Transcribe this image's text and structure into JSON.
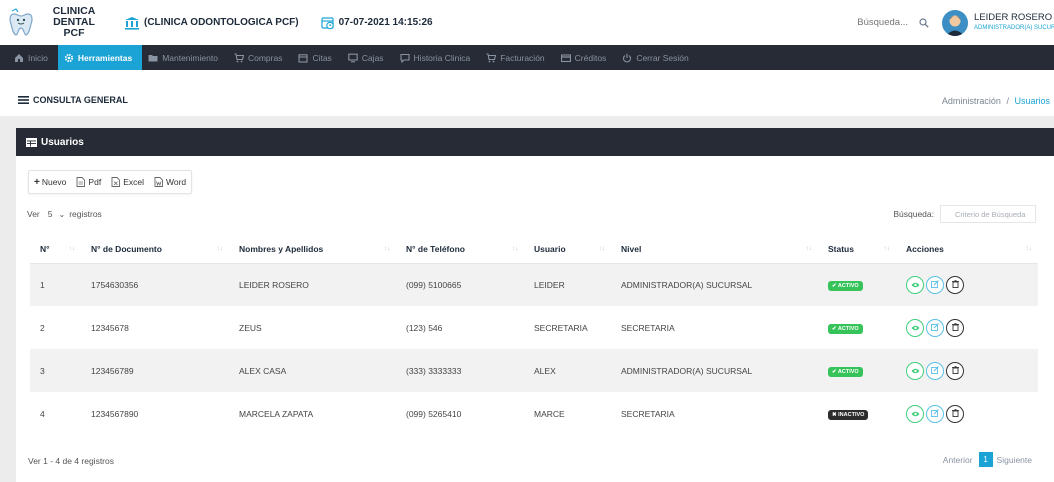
{
  "header": {
    "logo_line1": "CLINICA DENTAL",
    "logo_line2": "PCF",
    "clinic_name": "(CLINICA ODONTOLOGICA PCF)",
    "datetime": "07-07-2021 14:15:26",
    "search_placeholder": "Búsqueda...",
    "user_name": "LEIDER ROSERO",
    "user_role": "ADMINISTRADOR(A) SUCURSAL"
  },
  "nav": {
    "items": [
      {
        "label": "Inicio",
        "icon": "home-icon"
      },
      {
        "label": "Herramientas",
        "icon": "gear-icon",
        "active": true
      },
      {
        "label": "Mantenimiento",
        "icon": "folder-icon"
      },
      {
        "label": "Compras",
        "icon": "cart-icon"
      },
      {
        "label": "Citas",
        "icon": "calendar-icon"
      },
      {
        "label": "Cajas",
        "icon": "monitor-icon"
      },
      {
        "label": "Historia Clinica",
        "icon": "chat-icon"
      },
      {
        "label": "Facturación",
        "icon": "cart-icon"
      },
      {
        "label": "Créditos",
        "icon": "card-icon"
      },
      {
        "label": "Cerrar Sesión",
        "icon": "power-icon"
      }
    ]
  },
  "page": {
    "title": "CONSULTA GENERAL",
    "breadcrumb_parent": "Administración",
    "breadcrumb_sep": "/",
    "breadcrumb_current": "Usuarios"
  },
  "panel": {
    "title": "Usuarios"
  },
  "toolbar": {
    "new_label": "Nuevo",
    "pdf_label": "Pdf",
    "excel_label": "Excel",
    "word_label": "Word"
  },
  "table_controls": {
    "show_label": "Ver",
    "page_size": "5",
    "records_label": "registros",
    "search_label": "Búsqueda:",
    "search_placeholder": "Criterio de Búsqueda"
  },
  "table": {
    "columns": [
      "N°",
      "N° de Documento",
      "Nombres y Apellidos",
      "N° de Teléfono",
      "Usuario",
      "Nivel",
      "Status",
      "Acciones"
    ],
    "rows": [
      {
        "n": "1",
        "doc": "1754630356",
        "name": "LEIDER ROSERO",
        "phone": "(099) 5100665",
        "user": "LEIDER",
        "level": "ADMINISTRADOR(A) SUCURSAL",
        "status": "✔ ACTIVO",
        "active": true
      },
      {
        "n": "2",
        "doc": "12345678",
        "name": "ZEUS",
        "phone": "(123) 546",
        "user": "SECRETARIA",
        "level": "SECRETARIA",
        "status": "✔ ACTIVO",
        "active": true
      },
      {
        "n": "3",
        "doc": "123456789",
        "name": "ALEX CASA",
        "phone": "(333) 3333333",
        "user": "ALEX",
        "level": "ADMINISTRADOR(A) SUCURSAL",
        "status": "✔ ACTIVO",
        "active": true
      },
      {
        "n": "4",
        "doc": "1234567890",
        "name": "MARCELA ZAPATA",
        "phone": "(099) 5265410",
        "user": "MARCE",
        "level": "SECRETARIA",
        "status": "✖ INACTIVO",
        "active": false
      }
    ]
  },
  "footer": {
    "info": "Ver 1 - 4 de 4 registros",
    "prev_label": "Anterior",
    "current_page": "1",
    "next_label": "Siguiente"
  },
  "colors": {
    "accent": "#1aa3d4",
    "nav_bg": "#262b35",
    "active_badge": "#35c35a",
    "inactive_badge": "#2d2d2d"
  }
}
